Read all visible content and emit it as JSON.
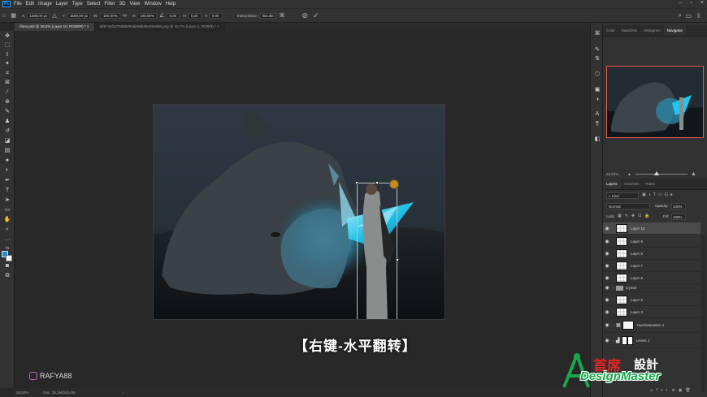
{
  "menubar": {
    "app_logo": "Ps",
    "items": [
      "File",
      "Edit",
      "Image",
      "Layer",
      "Type",
      "Select",
      "Filter",
      "3D",
      "View",
      "Window",
      "Help"
    ]
  },
  "options": {
    "x_label": "X:",
    "x_value": "1298,00 px",
    "y_label": "Y:",
    "y_value": "1609,00 px",
    "w_label": "W:",
    "w_value": "-100,00%",
    "h_label": "H:",
    "h_value": "100,00%",
    "angle_value": "0,00",
    "hskew_label": "H:",
    "hskew_value": "0,00",
    "vskew_label": "V:",
    "vskew_value": "0,00",
    "interp_label": "Interpolation:",
    "interp_value": "Bicubic"
  },
  "tabs": [
    {
      "label": "rhino.psd @ 26,5% (Layer 10, RGB/8#) *",
      "close": "×"
    },
    {
      "label": "8d574ef1476d88294de98b40e25e958.png @ 43,7% (Layer 1, RGB/8) *",
      "close": "×"
    }
  ],
  "caption": "【右键-水平翻转】",
  "watermark": {
    "handle": "RAFYA88"
  },
  "status": {
    "zoom": "26,53%",
    "doc": "Doc: 15,1M/243,4M",
    "arrow": "›"
  },
  "panel_tabs_top": [
    "Color",
    "Swatches",
    "Histogram",
    "Navigator"
  ],
  "navigator": {
    "zoom": "26,53%"
  },
  "layers_panel": {
    "tabs": [
      "Layers",
      "Channels",
      "Paths"
    ],
    "kind_filter": "Kind",
    "blend_mode": "Normal",
    "opacity_label": "Opacity:",
    "opacity_value": "100%",
    "lock_label": "Lock:",
    "fill_label": "Fill:",
    "fill_value": "100%",
    "layers": [
      {
        "name": "Layer 10",
        "selected": true,
        "clipped": false,
        "kind": "pixel"
      },
      {
        "name": "Layer 9",
        "selected": false,
        "clipped": false,
        "kind": "pixel"
      },
      {
        "name": "Layer 8",
        "selected": false,
        "clipped": false,
        "kind": "pixel"
      },
      {
        "name": "Layer 7",
        "selected": false,
        "clipped": true,
        "kind": "pixel"
      },
      {
        "name": "Layer 6",
        "selected": false,
        "clipped": true,
        "kind": "pixel"
      },
      {
        "name": "crystal",
        "selected": false,
        "clipped": false,
        "kind": "group"
      },
      {
        "name": "Layer 5",
        "selected": false,
        "clipped": true,
        "kind": "pixel"
      },
      {
        "name": "Layer 3",
        "selected": false,
        "clipped": true,
        "kind": "pixel"
      },
      {
        "name": "Hue/Saturation 1",
        "selected": false,
        "clipped": true,
        "kind": "adjustment"
      },
      {
        "name": "Levels 1",
        "selected": false,
        "clipped": true,
        "kind": "adjustment"
      }
    ]
  },
  "logo": {
    "cn_red": "首席",
    "cn_white": "設計",
    "en": "DesignMaster"
  },
  "colors": {
    "accent": "#31a8ff",
    "nav_border": "#e5574a",
    "glow": "#1fc8f0"
  }
}
